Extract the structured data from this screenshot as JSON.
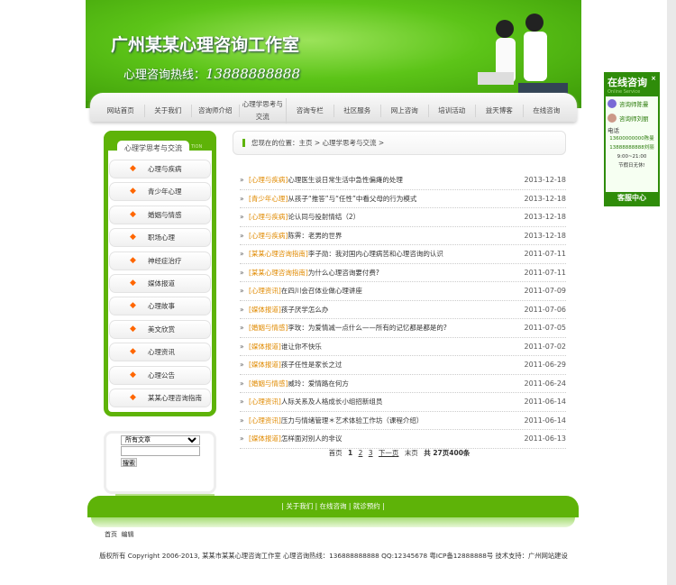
{
  "header": {
    "title": "广州某某心理咨询工作室",
    "hotline_label": "心理咨询热线：",
    "hotline": "13888888888"
  },
  "nav": [
    "网站首页",
    "关于我们",
    "咨询师介绍",
    "心理学思考与交流",
    "咨询专栏",
    "社区服务",
    "网上咨询",
    "培训活动",
    "益天博客",
    "在线咨询"
  ],
  "sidebar": {
    "title": "心理学思考与交流",
    "title_en": "TION",
    "items": [
      "心理与疾病",
      "青少年心理",
      "婚姻与情感",
      "职场心理",
      "神经症治疗",
      "媒体报道",
      "心理故事",
      "美文欣赏",
      "心理资讯",
      "心理公告",
      "某某心理咨询指南"
    ]
  },
  "search": {
    "select": "所有文章",
    "input": "",
    "button": "搜索"
  },
  "breadcrumb": "您现在的位置：主页 > 心理学思考与交流 >",
  "articles": [
    {
      "cat": "[心理与疾病]",
      "title": "心理医生谈日常生活中急性偏瘫的处理",
      "date": "2013-12-18"
    },
    {
      "cat": "[青少年心理]",
      "title": "从孩子“推答”与“任性”中看父母的行为模式",
      "date": "2013-12-18"
    },
    {
      "cat": "[心理与疾病]",
      "title": "论认同与投射情结（2）",
      "date": "2013-12-18"
    },
    {
      "cat": "[心理与疾病]",
      "title": "陈霁：老男的世界",
      "date": "2013-12-18"
    },
    {
      "cat": "[某某心理咨询指南]",
      "title": "李子勋：我对国内心理病苦和心理咨询的认识",
      "date": "2011-07-11"
    },
    {
      "cat": "[某某心理咨询指南]",
      "title": "为什么心理咨询要付费?",
      "date": "2011-07-11"
    },
    {
      "cat": "[心理资讯]",
      "title": "在四川会召体业做心理讲座",
      "date": "2011-07-09"
    },
    {
      "cat": "[媒体报道]",
      "title": "孩子厌学怎么办",
      "date": "2011-07-06"
    },
    {
      "cat": "[婚姻与情感]",
      "title": "李玫：为爱情减一点什么——所有的记忆都是都是的?",
      "date": "2011-07-05"
    },
    {
      "cat": "[媒体报道]",
      "title": "谁让你不快乐",
      "date": "2011-07-02"
    },
    {
      "cat": "[媒体报道]",
      "title": "孩子任性是家长之过",
      "date": "2011-06-29"
    },
    {
      "cat": "[婚姻与情感]",
      "title": "威玲：爱情路在何方",
      "date": "2011-06-24"
    },
    {
      "cat": "[心理资讯]",
      "title": "人际关系及人格成长小组招新组员",
      "date": "2011-06-14"
    },
    {
      "cat": "[心理资讯]",
      "title": "压力与情绪管理＊艺术体验工作坊（课程介绍）",
      "date": "2011-06-14"
    },
    {
      "cat": "[媒体报道]",
      "title": "怎样面对别人的非议",
      "date": "2011-06-13"
    }
  ],
  "pager": {
    "first": "首页",
    "current": "1",
    "p2": "2",
    "p3": "3",
    "next": "下一页",
    "last": "末页",
    "summary": "共 27页400条"
  },
  "footer": {
    "nav": "| 关于我们 | 在线咨询 | 就诊预约 |",
    "links": [
      "首页",
      "编辑"
    ],
    "copyright": "版权所有 Copyright 2006-2013, 某某市某某心理咨询工作室 心理咨询热线：136888888888 QQ:12345678 粤ICP备12888888号 技术支持：广州网站建设"
  },
  "float": {
    "title": "在线咨询",
    "subtitle": "Online Service",
    "qq1": "咨询师陈曼",
    "qq2": "咨询师刘丽",
    "tel_label": "电话",
    "tel1": "13600000000陈曼",
    "tel2": "13888888888刘丽",
    "hours": "9:00~21:00",
    "holiday": "节假日无休!",
    "footer": "客服中心",
    "close": "×"
  }
}
